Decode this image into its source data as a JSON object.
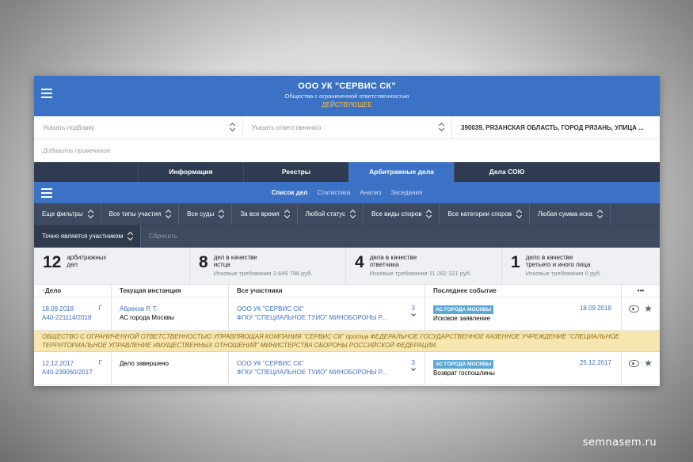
{
  "header": {
    "title": "ООО УК \"СЕРВИС СК\"",
    "subtitle": "Общества с ограниченной ответственностью",
    "status": "ДЕЙСТВУЮЩЕЕ"
  },
  "selectors": {
    "collection_placeholder": "Указать подборку",
    "responsible_placeholder": "Указать ответственного",
    "address": "390039, РЯЗАНСКАЯ ОБЛАСТЬ, ГОРОД РЯЗАНЬ, УЛИЦА ...",
    "note_placeholder": "Добавить примечание"
  },
  "main_tabs": [
    {
      "label": "Информация"
    },
    {
      "label": "Реестры"
    },
    {
      "label": "Арбитражные дела",
      "active": true
    },
    {
      "label": "Дела СОЮ"
    }
  ],
  "sub_tabs": [
    {
      "label": "Список дел",
      "active": true
    },
    {
      "label": "Статистика"
    },
    {
      "label": "Анализ"
    },
    {
      "label": "Заседания"
    }
  ],
  "filters": {
    "row1": [
      "Еще фильтры",
      "Все типы участия",
      "Все суды",
      "За все время",
      "Любой статус",
      "Все виды споров",
      "Все категории споров",
      "Любая сумма иска"
    ],
    "participant": "Точно является участником",
    "reset": "Сбросить"
  },
  "stats": [
    {
      "number": "12",
      "label1": "арбитражных",
      "label2": "дел",
      "sub": ""
    },
    {
      "number": "8",
      "label1": "дел в качестве",
      "label2": "истца",
      "sub": "Исковые требования 3 649 798 руб."
    },
    {
      "number": "4",
      "label1": "дела в качестве",
      "label2": "ответчика",
      "sub": "Исковые требования 11 282 321 руб."
    },
    {
      "number": "1",
      "label1": "дело в качестве",
      "label2": "третьего и иного лица",
      "sub": "Исковые требования 0 руб."
    }
  ],
  "table": {
    "headers": {
      "case": "↑Дело",
      "instance": "Текущая инстанция",
      "participants": "Все участники",
      "event": "Последнее событие",
      "more": "•••"
    },
    "rows": [
      {
        "date": "18.09.2018",
        "g": "Г",
        "number": "А40-221114/2018",
        "instance_line1": "Абреков Р. Т.",
        "instance_line2": "АС города Москвы",
        "party1": "ООО УК \"СЕРВИС СК\"",
        "party2": "ФГКУ \"СПЕЦИАЛЬНОЕ ТУИО\" МИНОБОРОНЫ Р...",
        "party_count": "3",
        "court_badge": "АС ГОРОДА МОСКВЫ",
        "event_date": "18.09.2018",
        "event": "Исковое заявление"
      },
      {
        "date": "12.12.2017",
        "g": "Г",
        "number": "А40-239060/2017",
        "instance_line1": "Дело завершено",
        "instance_line2": "",
        "party1": "ООО УК \"СЕРВИС СК\"",
        "party2": "ФГКУ \"СПЕЦИАЛЬНОЕ ТУИО\" МИНОБОРОНЫ Р...",
        "party_count": "3",
        "court_badge": "АС ГОРОДА МОСКВЫ",
        "event_date": "25.12.2017",
        "event": "Возврат госпошлины"
      }
    ],
    "notice": "ОБЩЕСТВО С ОГРАНИЧЕННОЙ ОТВЕТСТВЕННОСТЬЮ УПРАВЛЯЮЩАЯ КОМПАНИЯ \"СЕРВИС СК\" против ФЕДЕРАЛЬНОЕ ГОСУДАРСТВЕННОЕ КАЗЕННОЕ УЧРЕЖДЕНИЕ \"СПЕЦИАЛЬНОЕ ТЕРРИТОРИАЛЬНОЕ УПРАВЛЕНИЕ ИМУЩЕСТВЕННЫХ ОТНОШЕНИЙ\" МИНИСТЕРСТВА ОБОРОНЫ РОССИЙСКОЙ ФЕДЕРАЦИИ."
  },
  "watermark": "semnasem.ru",
  "colors": {
    "primary": "#3b72c5",
    "dark": "#2f3b50",
    "filter_bg": "#3d4a5f",
    "accent_status": "#f5c04a",
    "notice_bg": "#f8e6b0",
    "badge": "#5aa9d6"
  },
  "icons": [
    "menu-icon",
    "updown-chevron-icon",
    "eye-icon",
    "star-icon",
    "more-icon"
  ]
}
